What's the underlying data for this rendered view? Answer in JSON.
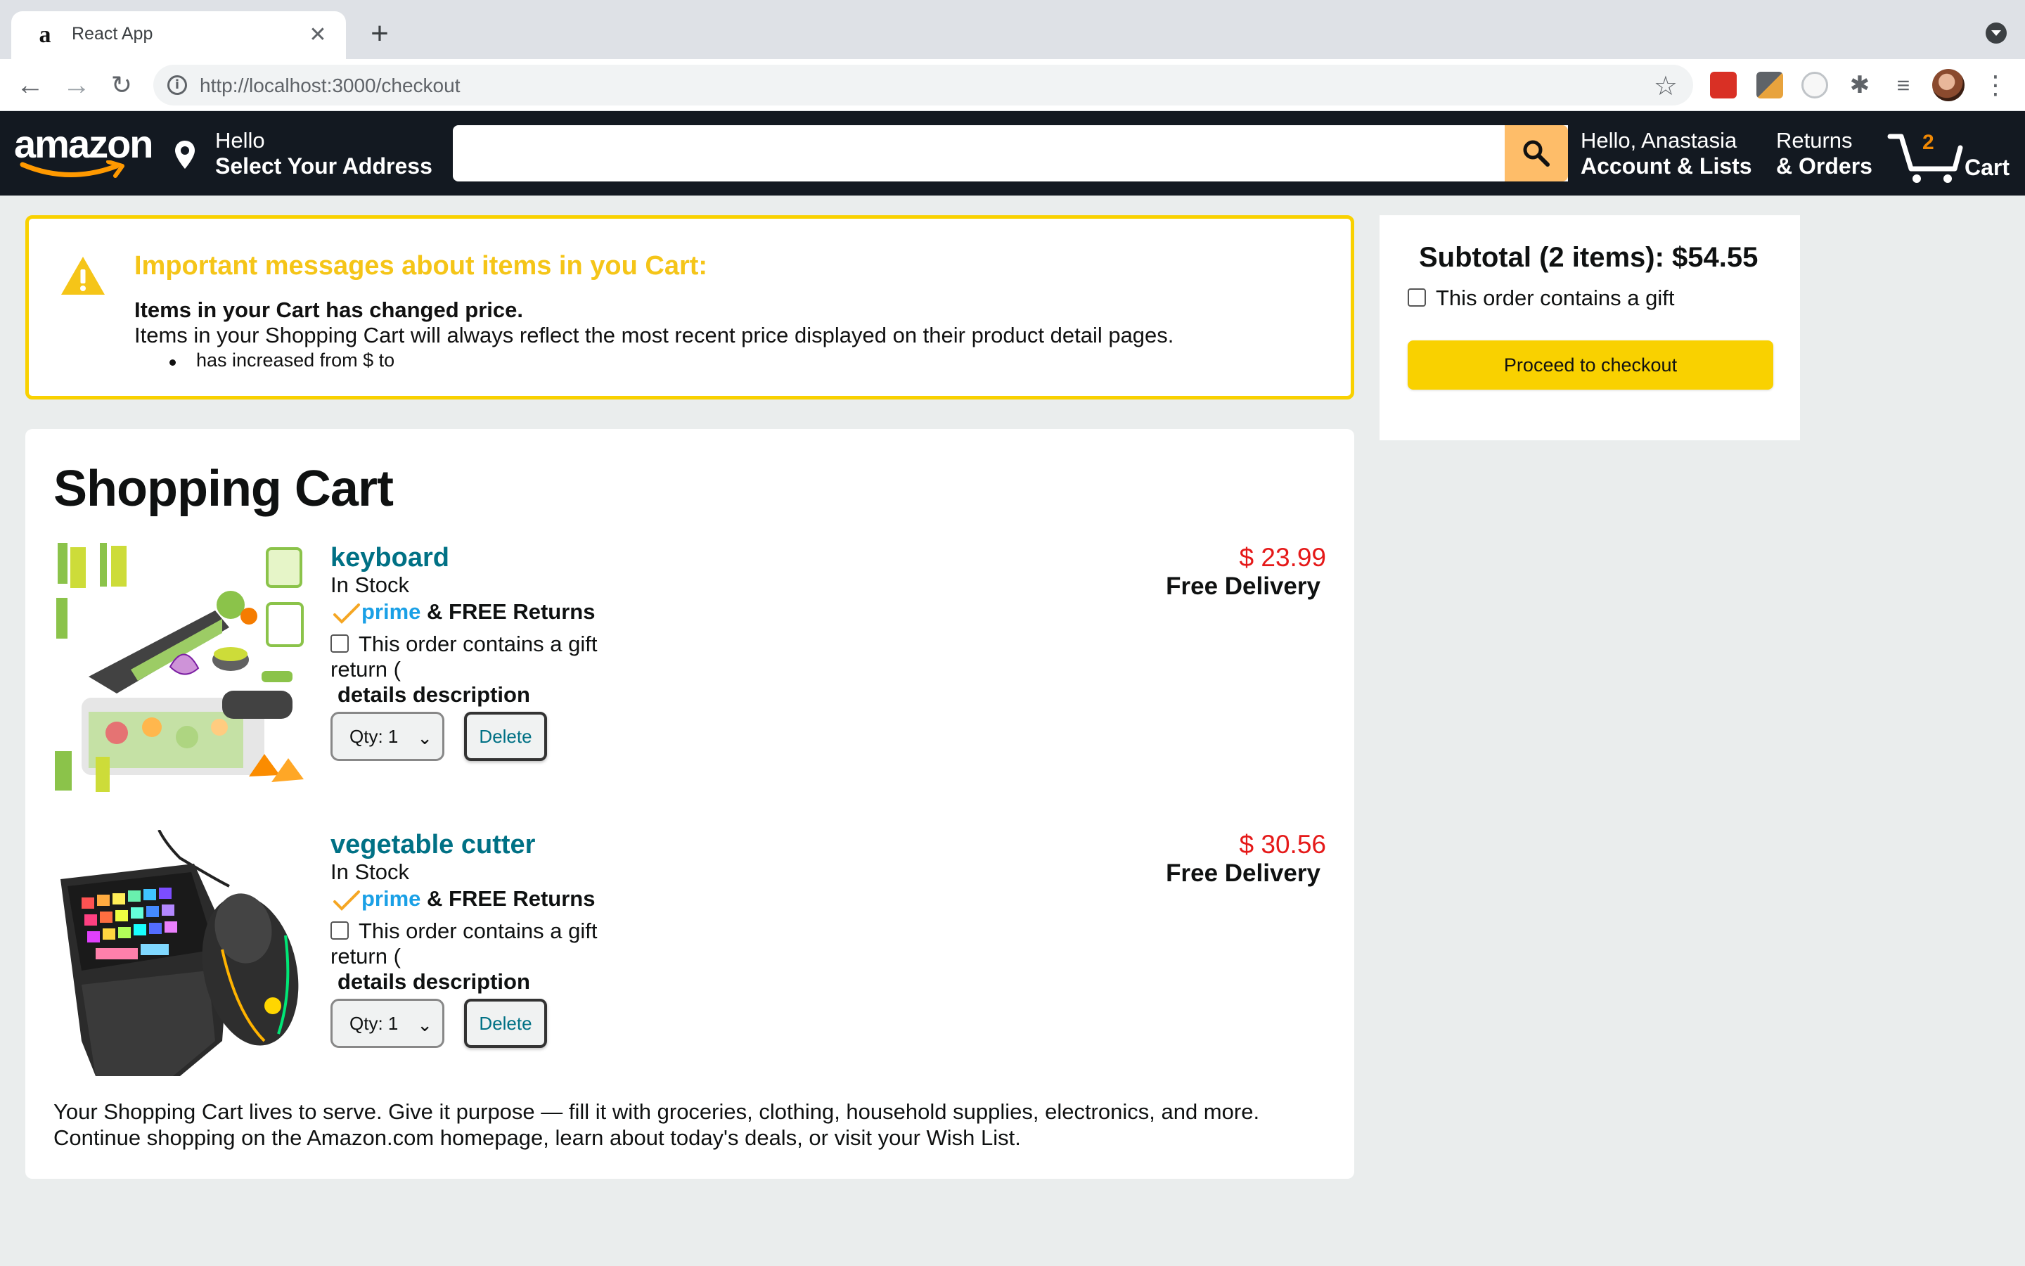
{
  "browser": {
    "tab_title": "React App",
    "tab_favicon": "a",
    "url_host": "http://localhost",
    "url_rest": ":3000/checkout"
  },
  "header": {
    "logo_text": "amazon",
    "address_line1": "Hello",
    "address_line2": "Select Your Address",
    "search_placeholder": "",
    "account_line1": "Hello, Anastasia",
    "account_line2": "Account & Lists",
    "orders_line1": "Returns",
    "orders_line2": "& Orders",
    "cart_count": "2",
    "cart_label": "Cart"
  },
  "notice": {
    "title": "Important messages about items in you Cart:",
    "line1": "Items in your Cart has changed price.",
    "line2": "Items in your Shopping Cart will always reflect the most recent price displayed on their product detail pages.",
    "bullet": "has increased from $  to"
  },
  "cart": {
    "title": "Shopping Cart",
    "items": [
      {
        "name": "keyboard",
        "stock": "In Stock",
        "prime": "prime",
        "returns": "& FREE Returns",
        "gift": "This order contains a gift",
        "return_text": "return (",
        "details": "details description",
        "qty": "Qty: 1",
        "delete": "Delete",
        "price": "$ 23.99",
        "delivery": "Free Delivery",
        "image": "vegetable-chopper-image"
      },
      {
        "name": "vegetable cutter",
        "stock": "In Stock",
        "prime": "prime",
        "returns": "& FREE Returns",
        "gift": "This order contains a gift",
        "return_text": "return (",
        "details": "details description",
        "qty": "Qty: 1",
        "delete": "Delete",
        "price": "$ 30.56",
        "delivery": "Free Delivery",
        "image": "gaming-keyboard-mouse-image"
      }
    ],
    "footer_line1": "Your Shopping Cart lives to serve. Give it purpose — fill it with groceries, clothing, household supplies, electronics, and more.",
    "footer_line2": "Continue shopping on the Amazon.com homepage, learn about today's deals, or visit your Wish List."
  },
  "subtotal": {
    "text": "Subtotal (2 items): $54.55",
    "gift": "This order contains a gift",
    "checkout": "Proceed to checkout"
  },
  "colors": {
    "header_bg": "#131921",
    "search_button": "#febd69",
    "notice_border": "#f9d100",
    "notice_title": "#f5c518",
    "link": "#007185",
    "price": "#e51919",
    "prime": "#1aa0e6",
    "checkout_button": "#f9d100"
  }
}
